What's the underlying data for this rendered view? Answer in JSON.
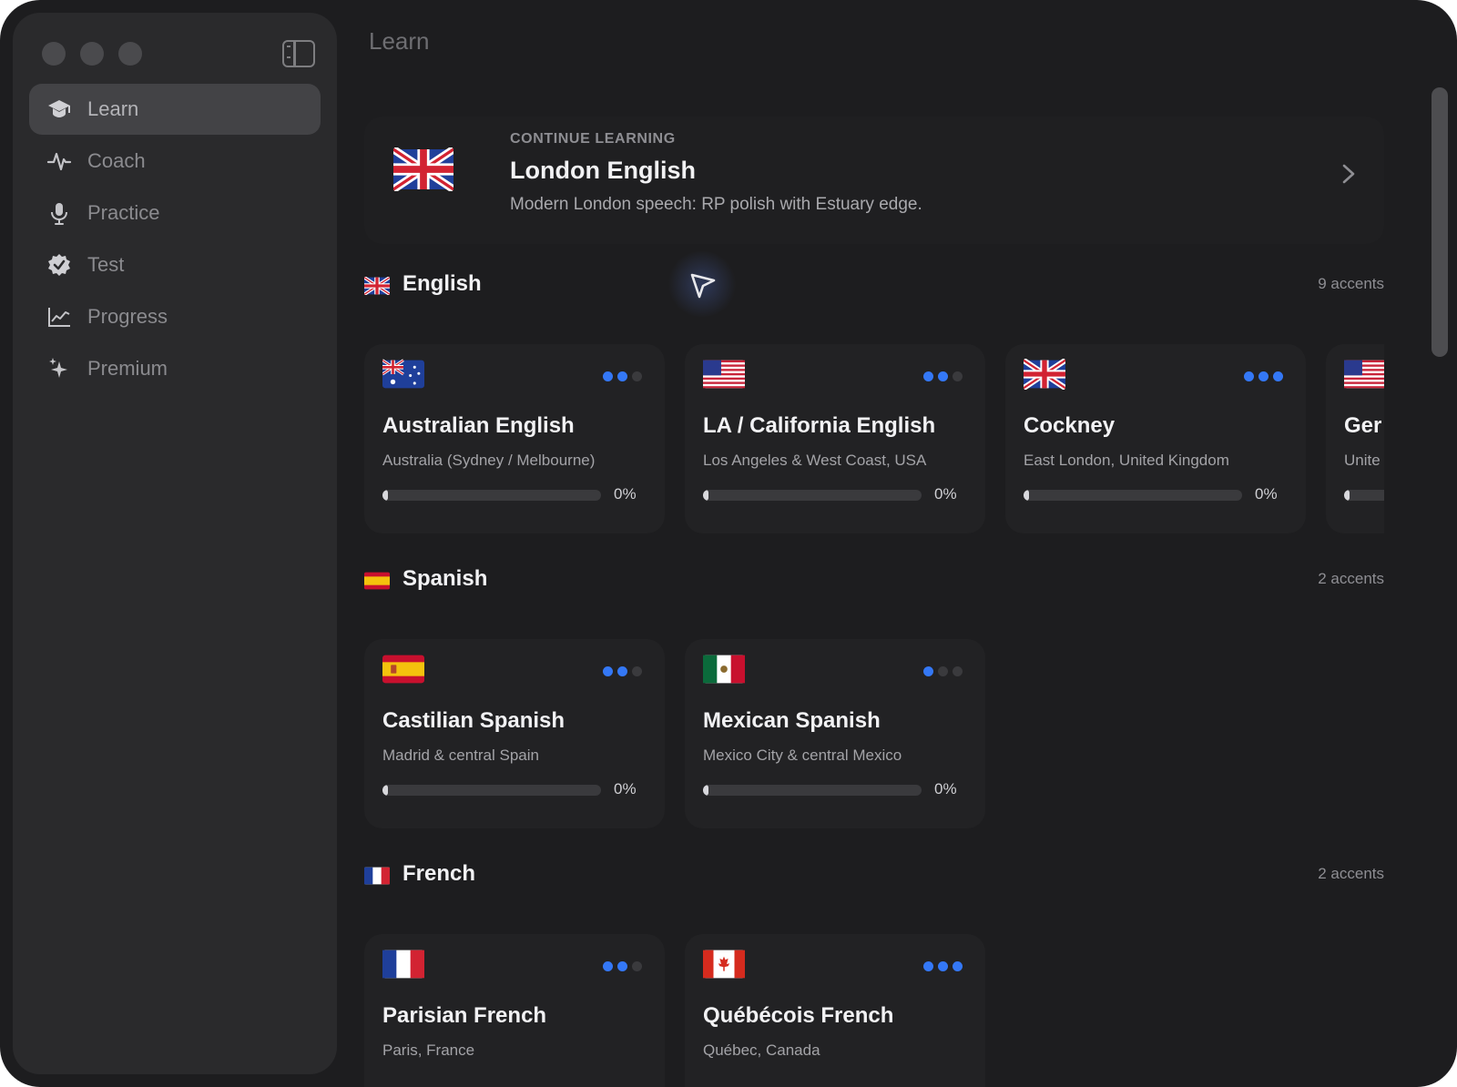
{
  "sidebar": {
    "items": [
      {
        "label": "Learn",
        "icon": "graduation-cap-icon",
        "active": true
      },
      {
        "label": "Coach",
        "icon": "waveform-pulse-icon",
        "active": false
      },
      {
        "label": "Practice",
        "icon": "microphone-icon",
        "active": false
      },
      {
        "label": "Test",
        "icon": "checkmark-seal-icon",
        "active": false
      },
      {
        "label": "Progress",
        "icon": "line-chart-icon",
        "active": false
      },
      {
        "label": "Premium",
        "icon": "sparkles-icon",
        "active": false
      }
    ]
  },
  "header": {
    "title": "Learn"
  },
  "continue_learning": {
    "kicker": "CONTINUE LEARNING",
    "title": "London English",
    "description": "Modern London speech: RP polish with Estuary edge.",
    "flag": "uk-flag-icon"
  },
  "sections": [
    {
      "name": "English",
      "count": "9 accents",
      "flag": "uk-flag-icon",
      "cards": [
        {
          "title": "Australian English",
          "subtitle": "Australia (Sydney / Melbourne)",
          "progress": "0%",
          "difficulty": 2,
          "flag": "australia-flag-icon"
        },
        {
          "title": "LA / California English",
          "subtitle": "Los Angeles & West Coast, USA",
          "progress": "0%",
          "difficulty": 2,
          "flag": "usa-flag-icon"
        },
        {
          "title": "Cockney",
          "subtitle": "East London, United Kingdom",
          "progress": "0%",
          "difficulty": 3,
          "flag": "uk-flag-icon"
        },
        {
          "title": "Ger",
          "subtitle": "Unite",
          "progress": "",
          "difficulty": 0,
          "flag": "usa-flag-icon"
        }
      ]
    },
    {
      "name": "Spanish",
      "count": "2 accents",
      "flag": "spain-flag-icon",
      "cards": [
        {
          "title": "Castilian Spanish",
          "subtitle": "Madrid & central Spain",
          "progress": "0%",
          "difficulty": 2,
          "flag": "spain-flag-icon"
        },
        {
          "title": "Mexican Spanish",
          "subtitle": "Mexico City & central Mexico",
          "progress": "0%",
          "difficulty": 1,
          "flag": "mexico-flag-icon"
        }
      ]
    },
    {
      "name": "French",
      "count": "2 accents",
      "flag": "france-flag-icon",
      "cards": [
        {
          "title": "Parisian French",
          "subtitle": "Paris, France",
          "progress": "",
          "difficulty": 2,
          "flag": "france-flag-icon"
        },
        {
          "title": "Québécois French",
          "subtitle": "Québec, Canada",
          "progress": "",
          "difficulty": 3,
          "flag": "canada-flag-icon"
        }
      ]
    }
  ],
  "colors": {
    "accent": "#3478f6",
    "background": "#1d1d1f",
    "sidebar": "#2a2a2c"
  }
}
